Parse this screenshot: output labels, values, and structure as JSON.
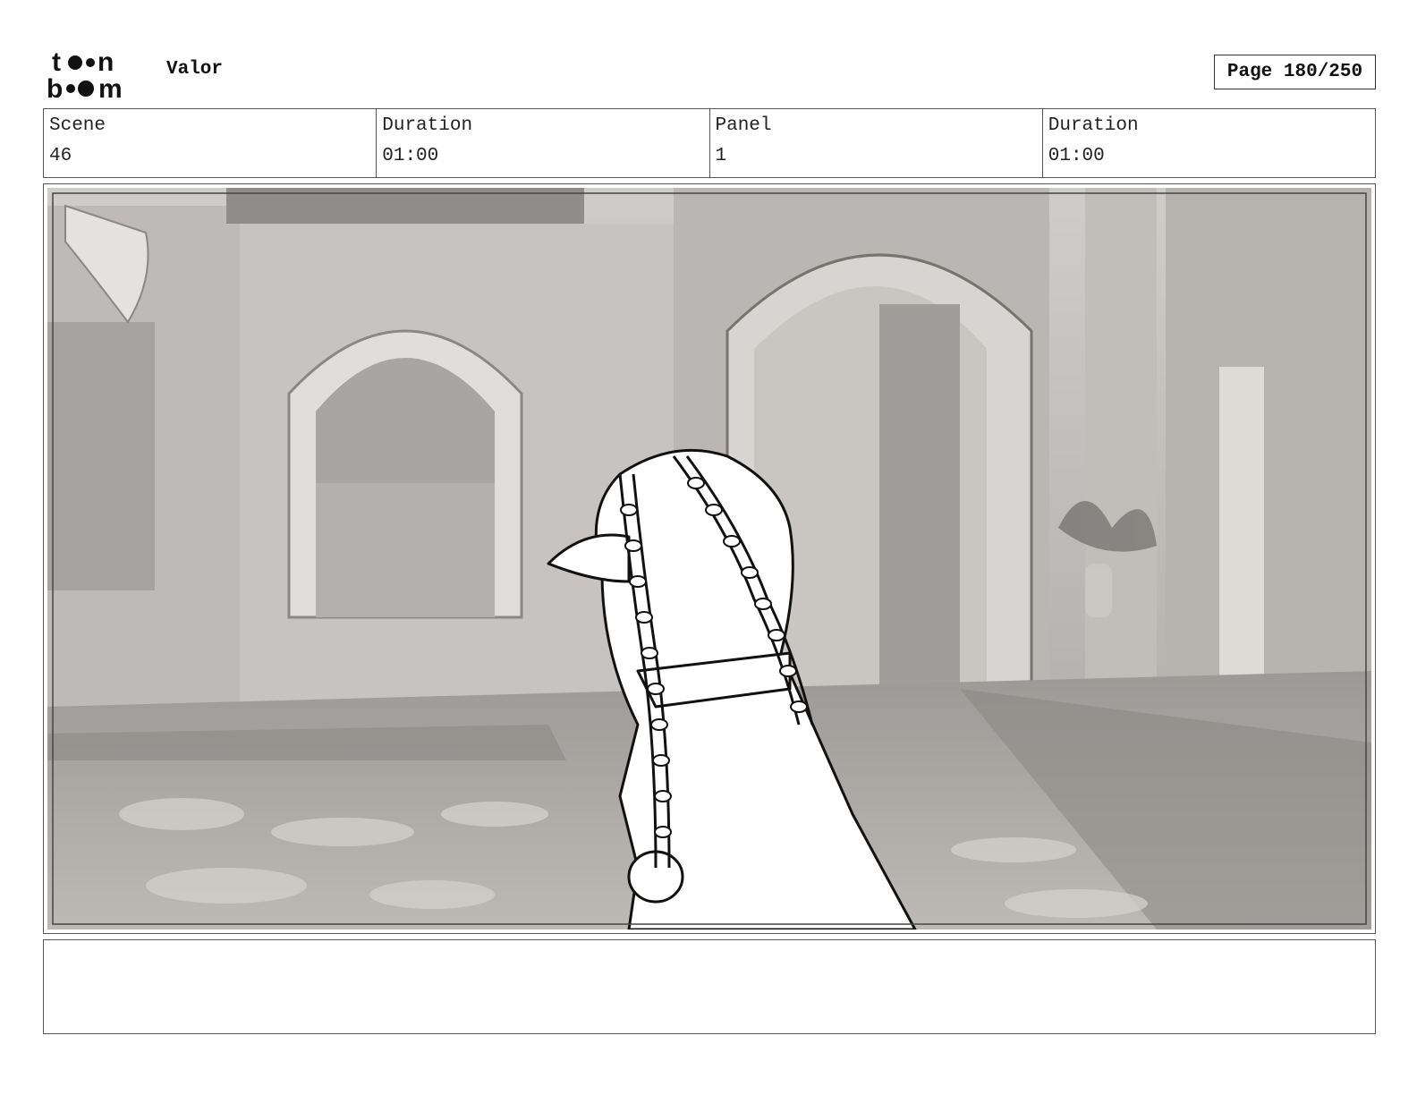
{
  "header": {
    "logo_text": "toon boom",
    "project_title": "Valor",
    "page_label": "Page 180/250"
  },
  "info": [
    {
      "label": "Scene",
      "value": "46"
    },
    {
      "label": "Duration",
      "value": "01:00"
    },
    {
      "label": "Panel",
      "value": "1"
    },
    {
      "label": "Duration",
      "value": "01:00"
    }
  ],
  "caption": {
    "text": ""
  },
  "colors": {
    "border": "#555555",
    "background": "#ffffff"
  }
}
